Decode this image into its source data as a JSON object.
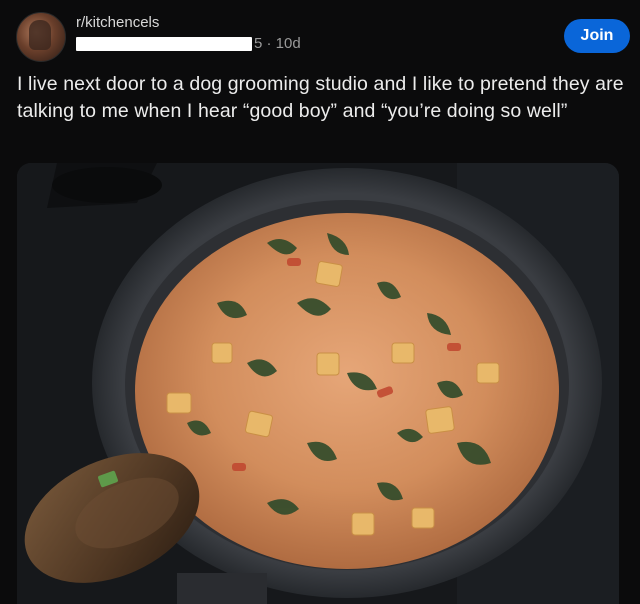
{
  "post": {
    "subreddit": "r/kitchencels",
    "meta_suffix": "5 · 10d",
    "join_label": "Join",
    "title": "I live next door to a dog grooming studio and I like to pretend they are talking to me when I hear “good boy” and “you’re doing so well”"
  },
  "colors": {
    "background": "#0b0b0c",
    "join_button": "#0a66d9",
    "text": "#ececec",
    "muted_text": "#9a9a9a"
  },
  "icons": {
    "avatar": "subreddit-avatar"
  }
}
